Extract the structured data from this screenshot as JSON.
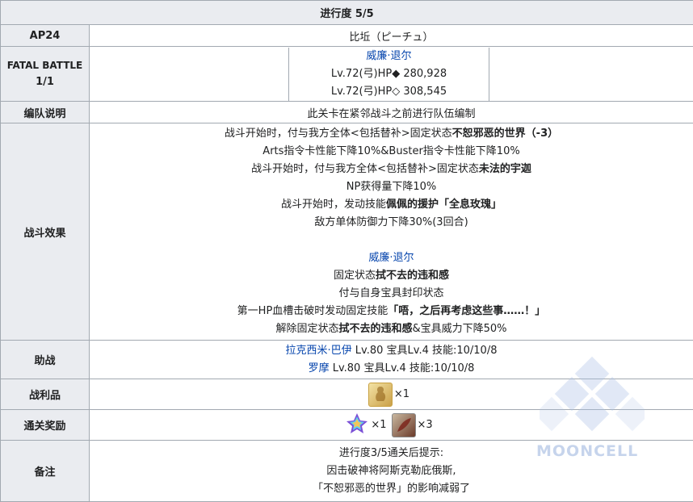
{
  "header": {
    "title": "进行度 5/5"
  },
  "ap": {
    "label": "AP24",
    "value": "比坵（ピーチュ）"
  },
  "fatal": {
    "label_line1": "FATAL BATTLE",
    "label_line2": "1/1",
    "enemy_name": "威廉·退尔",
    "hp_line1": "Lv.72(弓)HP◆ 280,928",
    "hp_line2": "Lv.72(弓)HP◇ 308,545"
  },
  "formation": {
    "label": "编队说明",
    "text": "此关卡在紧邻战斗之前进行队伍编制"
  },
  "effects": {
    "label": "战斗效果",
    "l1_pre": "战斗开始时，付与我方全体<包括替补>固定状态",
    "l1_bold": "不恕邪恶的世界（-3）",
    "l2": "Arts指令卡性能下降10%&Buster指令卡性能下降10%",
    "l3_pre": "战斗开始时，付与我方全体<包括替补>固定状态",
    "l3_bold": "未法的宇迦",
    "l4": "NP获得量下降10%",
    "l5_pre": "战斗开始时，发动技能",
    "l5_bold": "佩佩的援护「全息玫瑰」",
    "l6": "敌方单体防御力下降30%(3回合)",
    "enemy_name": "威廉·退尔",
    "l8_pre": "固定状态",
    "l8_bold": "拭不去的违和感",
    "l9": "付与自身宝具封印状态",
    "l10_pre": "第一HP血槽击破时发动固定技能",
    "l10_bold": "「唔，之后再考虑这些事……！」",
    "l11_pre": "解除固定状态",
    "l11_bold": "拭不去的违和感",
    "l11_post": "&宝具威力下降50%"
  },
  "support": {
    "label": "助战",
    "s1_name": "拉克西米·巴伊",
    "s1_rest": " Lv.80 宝具Lv.4 技能:10/10/8",
    "s2_name": "罗摩",
    "s2_rest": " Lv.80 宝具Lv.4 技能:10/10/8"
  },
  "drops": {
    "label": "战利品",
    "item1_mult": "×1"
  },
  "rewards": {
    "label": "通关奖励",
    "item1_mult": "×1",
    "item2_mult": "×3"
  },
  "notes": {
    "label": "备注",
    "line1": "进行度3/5通关后提示:",
    "line2": "因击破神将阿斯克勒庇俄斯,",
    "line3": "「不恕邪恶的世界」的影响减弱了"
  },
  "watermark": {
    "text": "MOONCELL"
  },
  "colors": {
    "header_bg": "#eaecf0",
    "border": "#a2a9b1",
    "link": "#0645ad"
  },
  "icons": [
    "gold-statue-icon",
    "saint-quartz-icon",
    "feather-material-icon",
    "mooncell-logo-icon"
  ]
}
